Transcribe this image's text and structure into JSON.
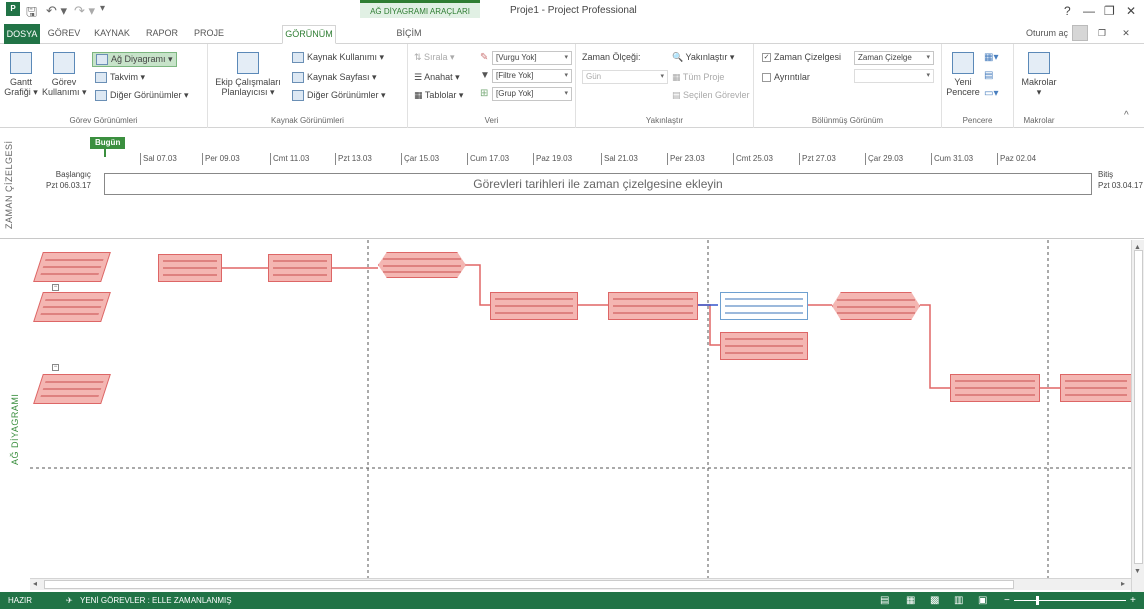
{
  "window": {
    "app_title": "Proje1 - Project Professional",
    "context_tab_header": "AĞ DİYAGRAMI ARAÇLARI",
    "signin": "Oturum aç",
    "help": "?"
  },
  "tabs": [
    "DOSYA",
    "GÖREV",
    "KAYNAK",
    "RAPOR",
    "PROJE",
    "GÖRÜNÜM",
    "BİÇİM"
  ],
  "ribbon": {
    "groups": {
      "task_views": "Görev Görünümleri",
      "resource_views": "Kaynak Görünümleri",
      "data": "Veri",
      "zoom": "Yakınlaştır",
      "split_view": "Bölünmüş Görünüm",
      "window": "Pencere",
      "macros": "Makrolar"
    },
    "gantt_line1": "Gantt",
    "gantt_line2": "Grafiği ▾",
    "task_usage_line1": "Görev",
    "task_usage_line2": "Kullanımı ▾",
    "network_diagram": "Ağ Diyagramı ▾",
    "calendar": "Takvim ▾",
    "other_views": "Diğer Görünümler ▾",
    "team_planner_line1": "Ekip Çalışmaları",
    "team_planner_line2": "Planlayıcısı ▾",
    "resource_usage": "Kaynak Kullanımı ▾",
    "resource_sheet": "Kaynak Sayfası ▾",
    "other_views2": "Diğer Görünümler ▾",
    "sort": "Sırala ▾",
    "outline": "Anahat ▾",
    "tables": "Tablolar ▾",
    "highlight": "[Vurgu Yok]",
    "filter": "[Filtre Yok]",
    "group": "[Grup Yok]",
    "timescale_label": "Zaman Ölçeği:",
    "timescale_value": "Gün",
    "zoom": "Yakınlaştır ▾",
    "entire_project": "Tüm Proje",
    "selected_tasks": "Seçilen Görevler",
    "timeline_check": "Zaman Çizelgesi",
    "timeline_combo": "Zaman Çizelge",
    "details_check": "Ayrıntılar",
    "new_window_line1": "Yeni",
    "new_window_line2": "Pencere",
    "macros_line1": "Makrolar",
    "macros_line2": "▾"
  },
  "timeline": {
    "side_label": "ZAMAN ÇİZELGESİ",
    "today": "Bugün",
    "start_label": "Başlangıç",
    "start_date": "Pzt 06.03.17",
    "end_label": "Bitiş",
    "end_date": "Pzt 03.04.17",
    "placeholder": "Görevleri tarihleri ile zaman çizelgesine ekleyin",
    "ticks": [
      "Sal 07.03",
      "Per 09.03",
      "Cmt 11.03",
      "Pzt 13.03",
      "Çar 15.03",
      "Cum 17.03",
      "Paz 19.03",
      "Sal 21.03",
      "Per 23.03",
      "Cmt 25.03",
      "Pzt 27.03",
      "Çar 29.03",
      "Cum 31.03",
      "Paz 02.04"
    ]
  },
  "network": {
    "side_label": "AĞ DİYAGRAMI"
  },
  "statusbar": {
    "ready": "HAZIR",
    "new_tasks": "YENİ GÖREVLER : ELLE ZAMANLANMIŞ"
  }
}
